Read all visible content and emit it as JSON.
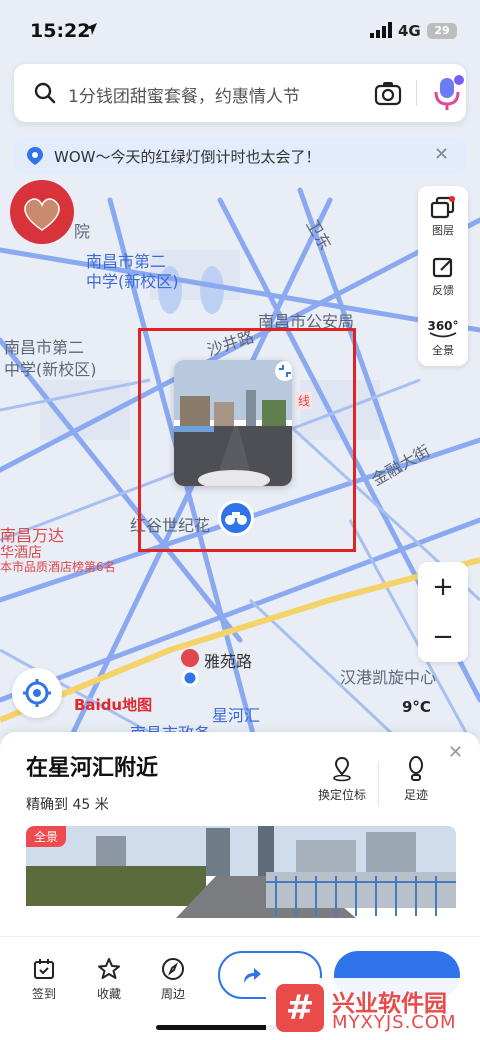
{
  "status_bar": {
    "time": "15:22",
    "network": "4G",
    "battery": "29"
  },
  "search": {
    "placeholder": "1分钱团甜蜜套餐，约惠情人节"
  },
  "banner": {
    "text": "WOW～今天的红绿灯倒计时也太会了！"
  },
  "map_labels": [
    {
      "text": "南昌市第二",
      "color": "blue"
    },
    {
      "text": "中学(新校区)",
      "color": "blue"
    },
    {
      "text": "南昌市第二",
      "color": "gray"
    },
    {
      "text": "中学(新校区)",
      "color": "gray"
    },
    {
      "text": "院",
      "color": "gray"
    },
    {
      "text": "南昌市公安局",
      "color": "gray"
    },
    {
      "text": "沙井路",
      "color": "gray"
    },
    {
      "text": "红谷世纪花",
      "color": "gray"
    },
    {
      "text": "金融大街",
      "color": "gray"
    },
    {
      "text": "卫东",
      "color": "gray"
    },
    {
      "text": "线",
      "color": "red"
    },
    {
      "text": "南昌万达",
      "color": "red"
    },
    {
      "text": "华酒店",
      "color": "red"
    },
    {
      "text": "本市品质酒店榜第6名",
      "color": "red"
    },
    {
      "text": "雅苑路",
      "color": "gray"
    },
    {
      "text": "汉港凯旋中心",
      "color": "gray"
    },
    {
      "text": "星河汇",
      "color": "blue"
    },
    {
      "text": "南昌市政务",
      "color": "blue"
    }
  ],
  "map_tools": [
    {
      "label": "图层",
      "icon": "layers-icon"
    },
    {
      "label": "反馈",
      "icon": "feedback-icon"
    },
    {
      "label": "全景",
      "icon": "panorama-360-icon",
      "badge": "360°"
    }
  ],
  "zoom": {
    "in": "+",
    "out": "−"
  },
  "brand": {
    "logo_text": "Baidu地图"
  },
  "weather": {
    "temp": "9°C"
  },
  "sheet": {
    "title": "在星河汇附近",
    "accuracy": "精确到 45 米",
    "actions": [
      {
        "label": "换定位标",
        "icon": "pin-swap-icon"
      },
      {
        "label": "足迹",
        "icon": "footprint-icon"
      }
    ],
    "pano_tag": "全景"
  },
  "bottom_nav": [
    {
      "label": "签到",
      "icon": "checkin-icon"
    },
    {
      "label": "收藏",
      "icon": "star-icon"
    },
    {
      "label": "周边",
      "icon": "compass-icon"
    }
  ],
  "watermark": {
    "badge": "#",
    "name": "兴业软件园",
    "url": "MYXYJS.COM"
  },
  "colors": {
    "accent": "#2f74ea",
    "highlight_box": "#e02424",
    "road": "#8aa9f0"
  }
}
